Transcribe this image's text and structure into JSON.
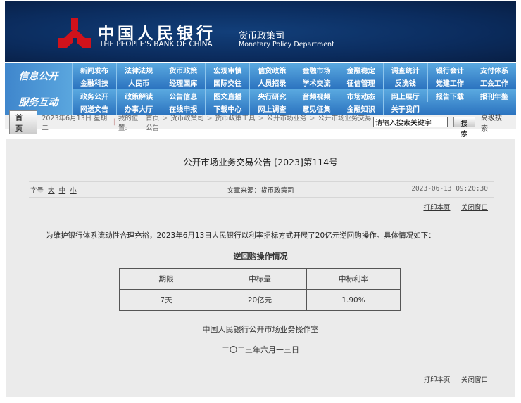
{
  "header": {
    "cn_name": "中国人民银行",
    "en_name": "THE PEOPLE'S BANK OF CHINA",
    "dept_cn": "货币政策司",
    "dept_en": "Monetary Policy Department",
    "logo_color": "#d0121b"
  },
  "nav": [
    {
      "label": "信息公开",
      "items": [
        "新闻发布",
        "法律法规",
        "货币政策",
        "宏观审慎",
        "信贷政策",
        "金融市场",
        "金融稳定",
        "调查统计",
        "银行会计",
        "支付体系",
        "金融科技",
        "人民币",
        "经理国库",
        "国际交往",
        "人员招录",
        "学术交流",
        "征信管理",
        "反洗钱",
        "党建工作",
        "工会工作"
      ]
    },
    {
      "label": "服务互动",
      "items": [
        "政务公开",
        "政策解读",
        "公告信息",
        "图文直播",
        "央行研究",
        "音频视频",
        "市场动态",
        "网上展厅",
        "报告下载",
        "报刊年鉴",
        "网送文告",
        "办事大厅",
        "在线申报",
        "下载中心",
        "网上调查",
        "意见征集",
        "金融知识",
        "关于我们"
      ]
    }
  ],
  "crumb": {
    "home": "首 页",
    "date": "2023年6月13日 星期二",
    "location_label": "我的位置:",
    "path": [
      "首页",
      "货币政策司",
      "货币政策工具",
      "公开市场业务",
      "公开市场业务交易公告"
    ],
    "search_value": "请输入搜索关键字",
    "search_btn": "搜索",
    "advanced": "高级搜索"
  },
  "article": {
    "title": "公开市场业务交易公告 [2023]第114号",
    "font_label": "字号",
    "font_sizes": [
      "大",
      "中",
      "小"
    ],
    "source": "文章来源：货币政策司",
    "datetime": "2023-06-13 09:20:30",
    "print": "打印本页",
    "close": "关闭窗口",
    "paragraph": "为维护银行体系流动性合理充裕，2023年6月13日人民银行以利率招标方式开展了20亿元逆回购操作。具体情况如下：",
    "table_title": "逆回购操作情况",
    "table_headers": [
      "期限",
      "中标量",
      "中标利率"
    ],
    "table_rows": [
      [
        "7天",
        "20亿元",
        "1.90%"
      ]
    ],
    "signature": "中国人民银行公开市场业务操作室",
    "sign_date": "二〇二三年六月十三日"
  }
}
